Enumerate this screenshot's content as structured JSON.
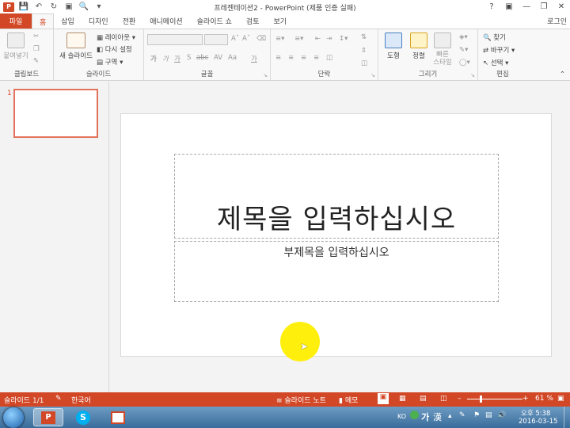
{
  "window": {
    "title": "프레젠테이션2 - PowerPoint (제품 인증 실패)",
    "help": "?"
  },
  "ribbon_tabs": [
    "파일",
    "홈",
    "삽입",
    "디자인",
    "전환",
    "애니메이션",
    "슬라이드 쇼",
    "검토",
    "보기"
  ],
  "active_tab": "홈",
  "account": "로그인",
  "groups": {
    "clipboard": {
      "label": "클립보드",
      "paste": "붙여넣기"
    },
    "slides": {
      "label": "슬라이드",
      "new_slide": "새 슬라이드",
      "layout": "레이아웃",
      "reset": "다시 설정",
      "section": "구역"
    },
    "font": {
      "label": "글꼴",
      "buttons": [
        "가",
        "가",
        "가",
        "S",
        "abc",
        "AV",
        "Aa",
        "가"
      ]
    },
    "paragraph": {
      "label": "단락"
    },
    "drawing": {
      "label": "그리기",
      "shapes": "도형",
      "arrange": "정렬",
      "quick_styles_1": "빠른",
      "quick_styles_2": "스타일"
    },
    "editing": {
      "label": "편집",
      "find": "찾기",
      "replace": "바꾸기",
      "select": "선택"
    }
  },
  "slide_pane": {
    "slide_number": "1"
  },
  "slide": {
    "title_placeholder": "제목을 입력하십시오",
    "subtitle_placeholder": "부제목을 입력하십시오"
  },
  "status": {
    "slide": "슬라이드 1/1",
    "language": "한국어",
    "notes": "슬라이드 노트",
    "comments": "메모",
    "zoom": "61 %"
  },
  "taskbar": {
    "ime": "KO",
    "ime_mode": "가",
    "ime_hanja": "漢",
    "time": "오후 5:38",
    "date": "2016-03-15"
  },
  "colors": {
    "accent": "#d24726",
    "highlight": "#ffee00"
  }
}
